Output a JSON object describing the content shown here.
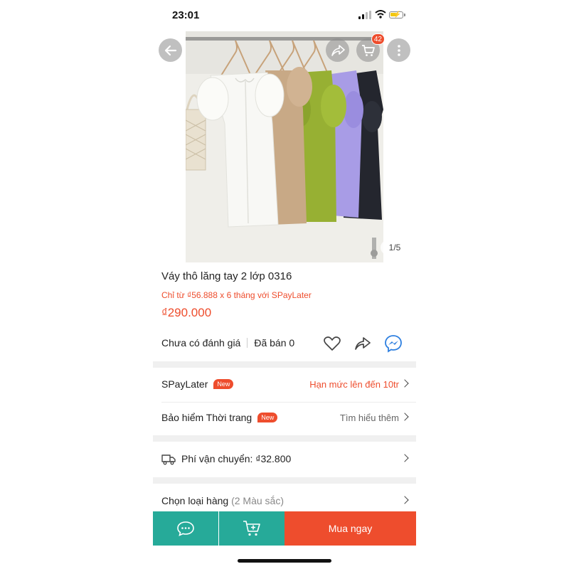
{
  "status_bar": {
    "time": "23:01"
  },
  "product": {
    "image_counter": "1/5",
    "title": "Váy thô lăng tay 2 lớp 0316",
    "installment_text": "Chỉ từ ₫56.888 x 6 tháng với SPayLater",
    "price": "₫290.000",
    "rating_text": "Chưa có đánh giá",
    "sold_text": "Đã bán 0"
  },
  "cart": {
    "count": "42"
  },
  "rows": {
    "spaylater": {
      "label": "SPayLater",
      "badge": "New",
      "right": "Hạn mức lên đến 10tr"
    },
    "insurance": {
      "label": "Bảo hiểm Thời trang",
      "badge": "New",
      "right": "Tìm hiểu thêm"
    },
    "shipping": {
      "label": "Phí vận chuyển: ₫32.800"
    },
    "variant": {
      "label": "Chọn loại hàng",
      "detail": "(2 Màu sắc)"
    }
  },
  "bottom_bar": {
    "buy_label": "Mua ngay"
  },
  "colors": {
    "accent": "#ee4d2d",
    "teal": "#26aa99",
    "dress_colors": [
      "#f7f7f4",
      "#c9ab8a",
      "#9ab133",
      "#a79ae6",
      "#22252e"
    ]
  },
  "icons": [
    "back-arrow-icon",
    "share-icon",
    "cart-icon",
    "more-icon",
    "heart-icon",
    "messenger-icon",
    "truck-icon",
    "chevron-right-icon",
    "chat-icon",
    "add-to-cart-icon"
  ]
}
